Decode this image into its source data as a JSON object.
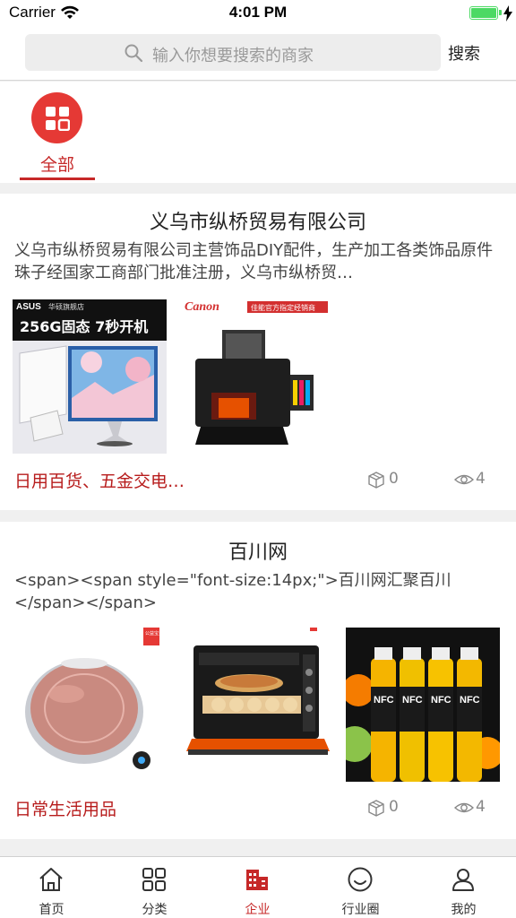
{
  "status_bar": {
    "carrier": "Carrier",
    "time": "4:01 PM"
  },
  "search": {
    "placeholder": "输入你想要搜索的商家",
    "button_label": "搜索"
  },
  "categories": [
    {
      "label": "全部",
      "icon": "grid-icon",
      "active": true
    }
  ],
  "merchants": [
    {
      "title": "义乌市纵桥贸易有限公司",
      "description": "义乌市纵桥贸易有限公司主营饰品DIY配件，生产加工各类饰品原件珠子经国家工商部门批准注册，义乌市纵桥贸…",
      "products": [
        {
          "name": "asus-all-in-one-pc",
          "banner_brand": "ASUS",
          "banner_store": "华硕旗舰店",
          "banner_text": "256G固态 7秒开机"
        },
        {
          "name": "canon-printer",
          "banner_brand": "Canon",
          "banner_store": "佳能官方指定经销商"
        }
      ],
      "categories_text": "日用百货、五金交电…",
      "product_count": "0",
      "view_count": "4"
    },
    {
      "title": "百川网",
      "description": "<span><span style=\"font-size:14px;\">百川网汇聚百川</span></span>",
      "products": [
        {
          "name": "robot-vacuum",
          "badge": "公益宝贝"
        },
        {
          "name": "electric-oven"
        },
        {
          "name": "nfc-juice-bottles",
          "bottle_label": "NFC"
        }
      ],
      "categories_text": "日常生活用品",
      "product_count": "0",
      "view_count": "4"
    }
  ],
  "tab_bar": [
    {
      "label": "首页",
      "icon": "home-icon"
    },
    {
      "label": "分类",
      "icon": "grid-icon"
    },
    {
      "label": "企业",
      "icon": "building-icon",
      "active": true
    },
    {
      "label": "行业圈",
      "icon": "smile-icon"
    },
    {
      "label": "我的",
      "icon": "user-icon"
    }
  ],
  "colors": {
    "accent": "#c62828",
    "category_circle": "#e53935",
    "battery": "#4cd964"
  }
}
